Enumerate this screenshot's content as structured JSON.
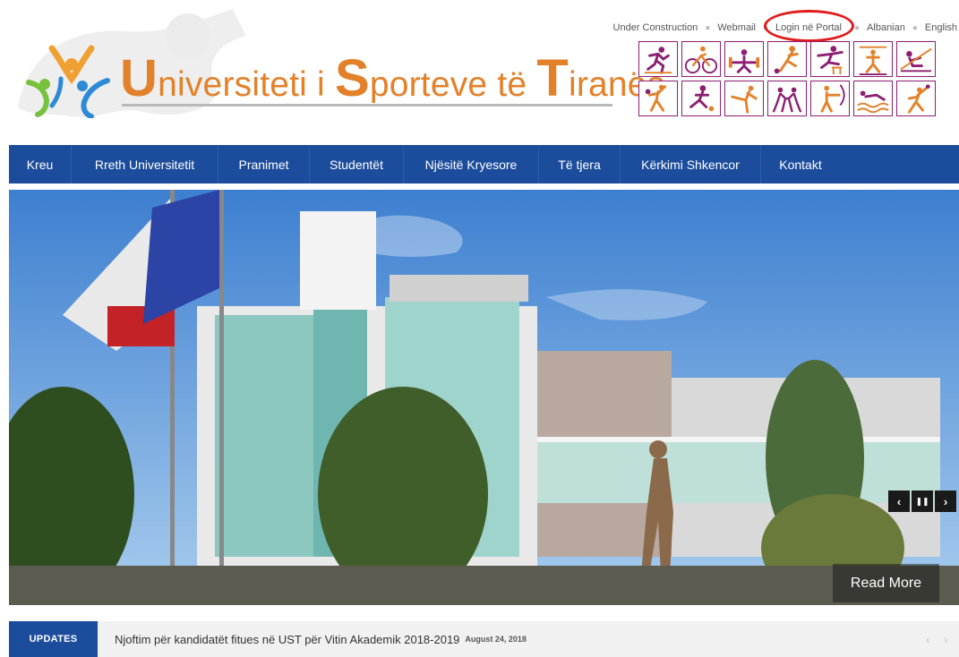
{
  "header": {
    "title": {
      "u": "U",
      "u_rest": "niversiteti i ",
      "s": "S",
      "s_rest": "porteve të ",
      "t": "T",
      "t_rest": "iranës"
    },
    "top_links": [
      {
        "label": "Under Construction"
      },
      {
        "label": "Webmail"
      },
      {
        "label": "Login në Portal"
      },
      {
        "label": "Albanian"
      },
      {
        "label": "English"
      }
    ]
  },
  "colors": {
    "nav_bg": "#1c4d9c",
    "title_orange": "#e3812a",
    "sport_icon": "#8d1e72",
    "highlight_ring": "#e01b1b"
  },
  "nav": {
    "items": [
      {
        "label": "Kreu"
      },
      {
        "label": "Rreth Universitetit"
      },
      {
        "label": "Pranimet"
      },
      {
        "label": "Studentët"
      },
      {
        "label": "Njësitë Kryesore"
      },
      {
        "label": "Të tjera"
      },
      {
        "label": "Kërkimi Shkencor"
      },
      {
        "label": "Kontakt"
      }
    ]
  },
  "slider": {
    "read_more": "Read More",
    "controls": {
      "prev": "‹",
      "pause": "❚❚",
      "next": "›"
    }
  },
  "updates": {
    "label": "UPDATES",
    "headline": "Njoftim për kandidatët fitues në UST për Vitin Akademik 2018-2019",
    "date": "August 24, 2018",
    "prev": "‹",
    "next": "›"
  },
  "sport_icons": [
    "running-icon",
    "cycling-icon",
    "weightlifting-icon",
    "football-icon",
    "hurdles-icon",
    "gymnastics-icon",
    "rowing-icon",
    "basketball-icon",
    "soccer-icon",
    "ballet-icon",
    "wrestling-icon",
    "archery-icon",
    "swimming-icon",
    "volleyball-icon"
  ]
}
